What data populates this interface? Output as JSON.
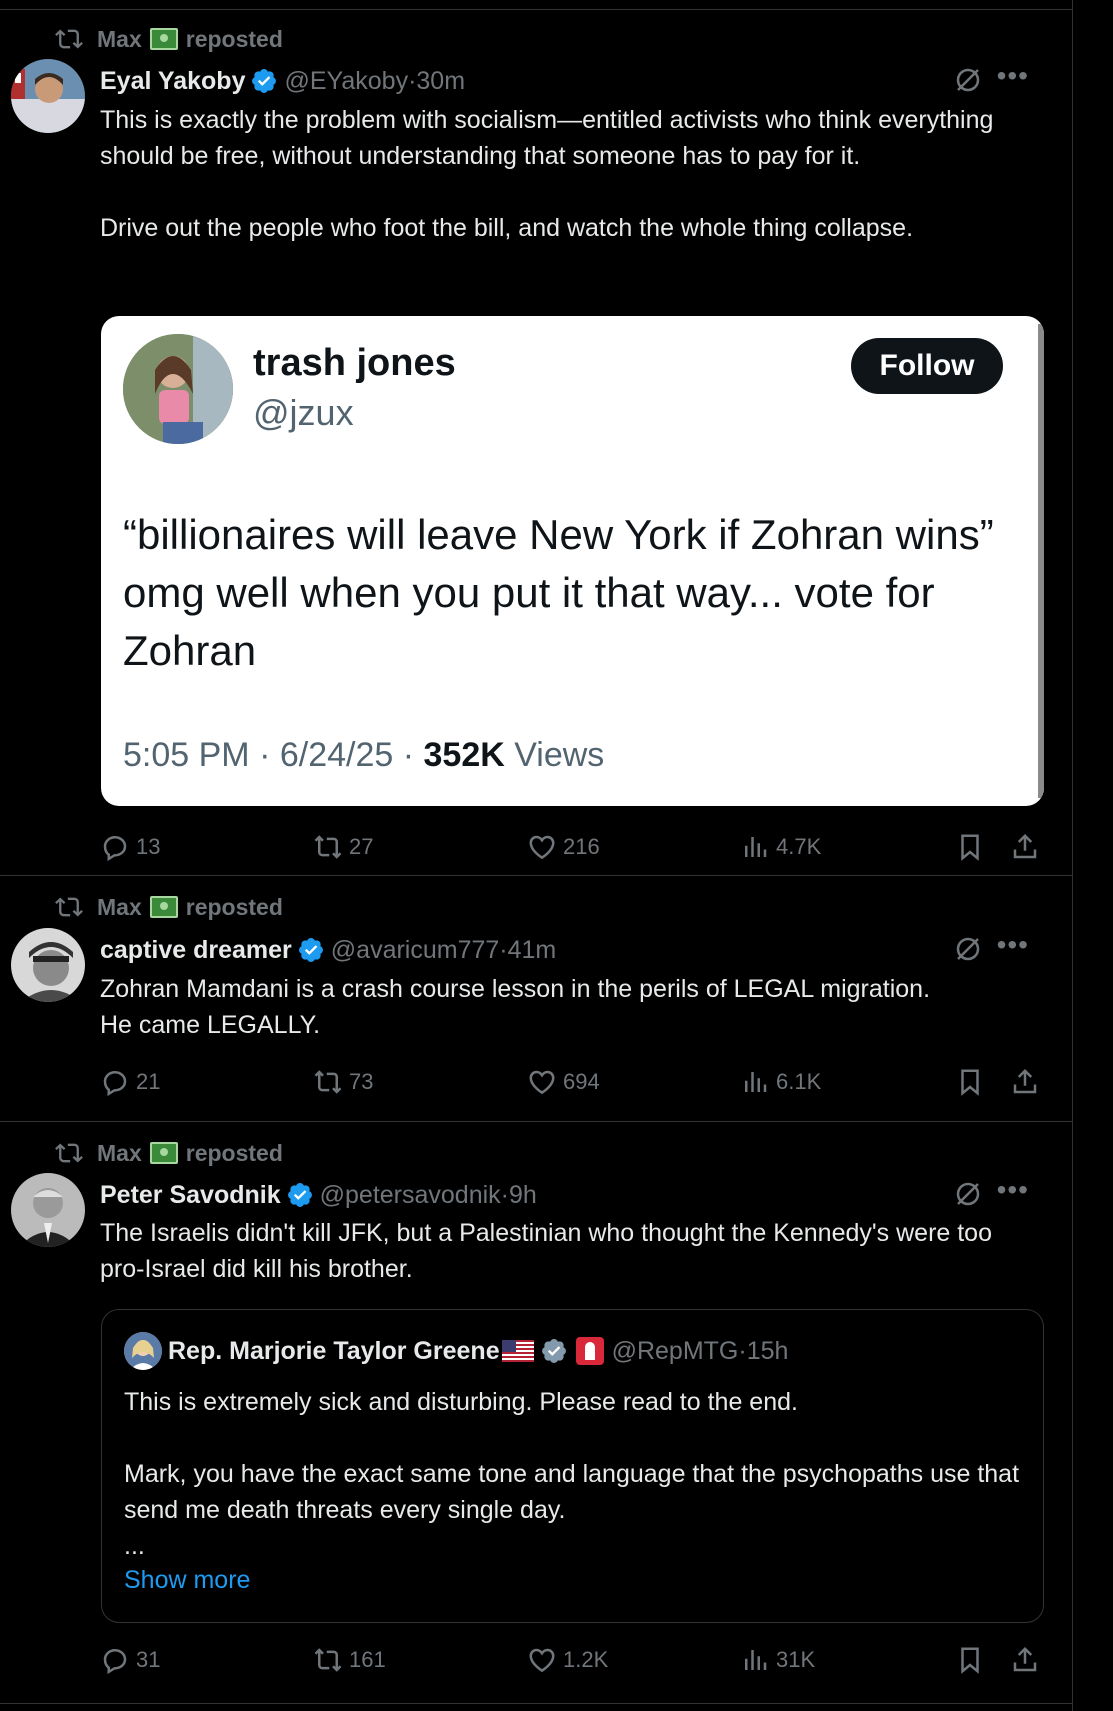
{
  "posts": [
    {
      "reposter": "Max",
      "reposted_label": "reposted",
      "name": "Eyal Yakoby",
      "handle": "@EYakoby",
      "time": "30m",
      "text": "This is exactly the problem with socialism—entitled activists who think everything should be free, without understanding that someone has to pay for it.\n\nDrive out the people who foot the bill, and watch the whole thing collapse.",
      "quote": {
        "name": "trash jones",
        "handle": "@jzux",
        "follow_label": "Follow",
        "text": "“billionaires will leave New York if Zohran wins” omg well when you put it that way... vote for Zohran",
        "time": "5:05 PM · 6/24/25 · ",
        "views_count": "352K",
        "views_label": " Views"
      },
      "replies": "13",
      "reposts": "27",
      "likes": "216",
      "views": "4.7K"
    },
    {
      "reposter": "Max",
      "reposted_label": "reposted",
      "name": "captive dreamer",
      "handle": "@avaricum777",
      "time": "41m",
      "text": "Zohran Mamdani is a crash course lesson in the perils of LEGAL migration.\nHe came LEGALLY.",
      "replies": "21",
      "reposts": "73",
      "likes": "694",
      "views": "6.1K"
    },
    {
      "reposter": "Max",
      "reposted_label": "reposted",
      "name": "Peter Savodnik",
      "handle": "@petersavodnik",
      "time": "9h",
      "text": "The Israelis didn't kill JFK, but a Palestinian who thought the Kennedy's were too pro-Israel did kill his brother.",
      "quote": {
        "name": "Rep. Marjorie Taylor Greene",
        "handle": "@RepMTG",
        "time": "15h",
        "text": "This is extremely sick and disturbing. Please read to the end.\n\nMark, you have the exact same tone and language that the psychopaths use that send me death threats every single day.\n...",
        "show_more": "Show more"
      },
      "replies": "31",
      "reposts": "161",
      "likes": "1.2K",
      "views": "31K"
    }
  ],
  "separator": " · ",
  "colors": {
    "verified": "#1d9bf0",
    "link": "#1d9bf0",
    "muted": "#71767b"
  },
  "icons": [
    "repost-icon",
    "verified-icon",
    "grok-icon",
    "more-icon",
    "reply-icon",
    "like-icon",
    "views-icon",
    "bookmark-icon",
    "share-icon"
  ]
}
